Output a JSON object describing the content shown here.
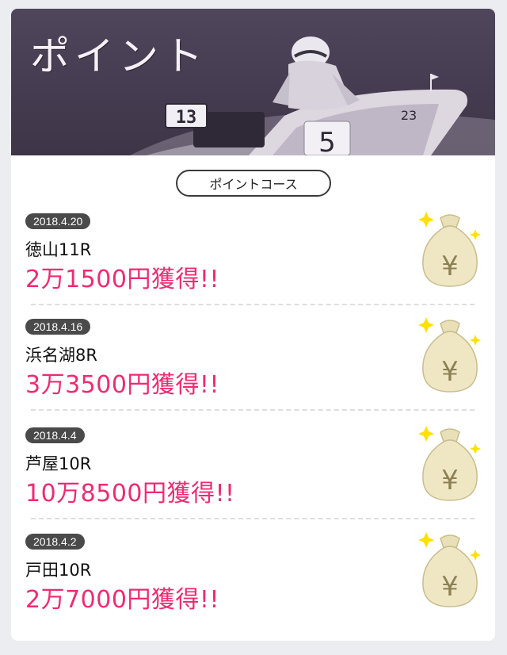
{
  "banner": {
    "title": "ポイント"
  },
  "course": {
    "label": "ポイントコース"
  },
  "kart_numbers": [
    "13",
    "5",
    "23"
  ],
  "entries": [
    {
      "date": "2018.4.20",
      "race": "徳山11R",
      "amount": "2万1500円獲得!!"
    },
    {
      "date": "2018.4.16",
      "race": "浜名湖8R",
      "amount": "3万3500円獲得!!"
    },
    {
      "date": "2018.4.4",
      "race": "芦屋10R",
      "amount": "10万8500円獲得!!"
    },
    {
      "date": "2018.4.2",
      "race": "戸田10R",
      "amount": "2万7000円獲得!!"
    }
  ],
  "icons": {
    "money_bag": "money-bag-yen-icon",
    "sparkle": "sparkle-icon"
  },
  "colors": {
    "accent": "#ee2b73",
    "banner": "#4a4055",
    "badge": "#4a4a4a"
  }
}
